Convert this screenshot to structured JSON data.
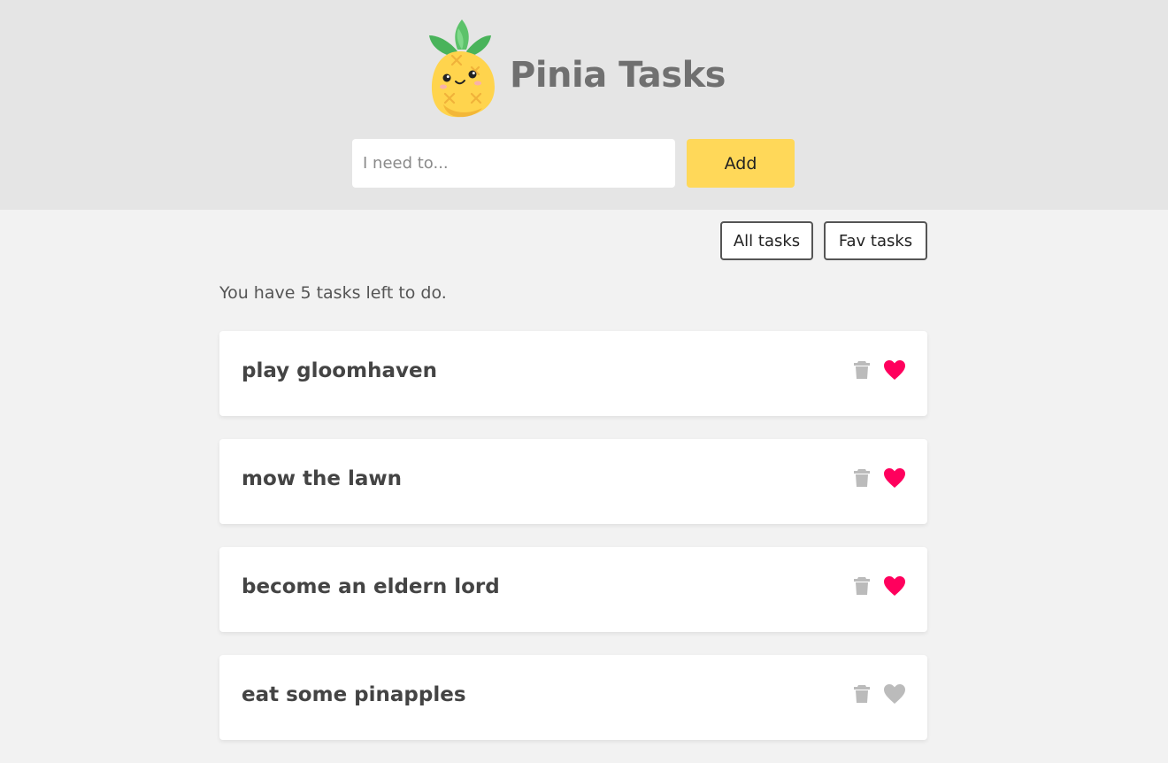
{
  "app": {
    "title": "Pinia Tasks"
  },
  "form": {
    "placeholder": "I need to...",
    "value": "",
    "add_label": "Add"
  },
  "filters": {
    "all_label": "All tasks",
    "fav_label": "Fav tasks"
  },
  "summary_text": "You have 5 tasks left to do.",
  "colors": {
    "header_bg": "#e5e5e5",
    "page_bg": "#f2f2f2",
    "accent_yellow": "#ffd859",
    "fav_active": "#ff005d",
    "icon_inactive": "#bbbbbb"
  },
  "tasks": [
    {
      "title": "play gloomhaven",
      "is_fav": true,
      "delete_icon": "trash-icon",
      "fav_icon": "heart-icon"
    },
    {
      "title": "mow the lawn",
      "is_fav": true,
      "delete_icon": "trash-icon",
      "fav_icon": "heart-icon"
    },
    {
      "title": "become an eldern lord",
      "is_fav": true,
      "delete_icon": "trash-icon",
      "fav_icon": "heart-icon"
    },
    {
      "title": "eat some pinapples",
      "is_fav": false,
      "delete_icon": "trash-icon",
      "fav_icon": "heart-icon"
    }
  ]
}
